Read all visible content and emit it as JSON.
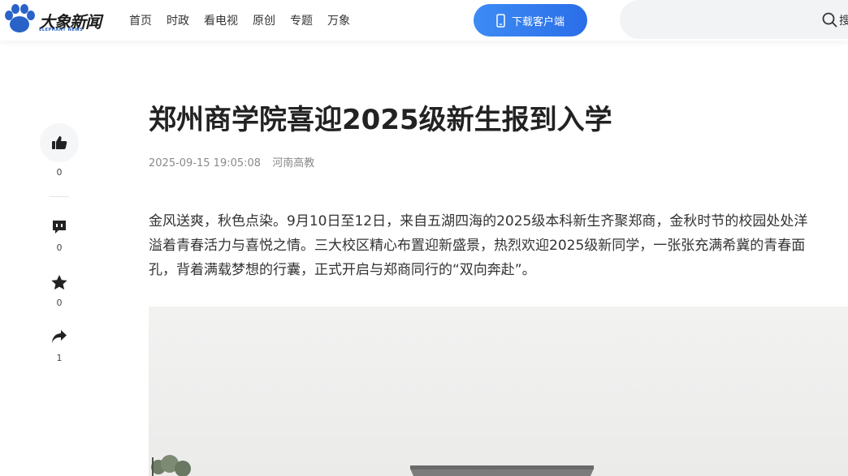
{
  "header": {
    "logo_text": "大象新闻",
    "logo_subtext": "ELEPHANT NEWS",
    "nav": [
      {
        "label": "首页"
      },
      {
        "label": "时政"
      },
      {
        "label": "看电视"
      },
      {
        "label": "原创"
      },
      {
        "label": "专题"
      },
      {
        "label": "万象"
      }
    ],
    "download_label": "下载客户端",
    "search_label": "搜"
  },
  "article": {
    "title": "郑州商学院喜迎2025级新生报到入学",
    "date": "2025-09-15 19:05:08",
    "source": "河南高教",
    "paragraph_lines": [
      "金风送爽，秋色点染。9月10日至12日，来自五湖四海的2025级本科新生齐聚郑商，金秋时节的校园处处洋",
      "溢着青春活力与喜悦之情。三大校区精心布置迎新盛景，热烈欢迎2025级新同学，一张张充满希冀的青春面",
      "孔，背着满载梦想的行囊，正式开启与郑商同行的“双向奔赴”。"
    ]
  },
  "sidebar": {
    "like_count": "0",
    "comment_count": "0",
    "favorite_count": "0",
    "share_count": "1"
  },
  "colors": {
    "accent": "#2a6ee8",
    "logo_blue": "#2a63c8"
  },
  "icons": [
    "paw-logo-icon",
    "phone-icon",
    "search-icon",
    "thumbs-up-icon",
    "comment-icon",
    "star-icon",
    "share-icon"
  ]
}
